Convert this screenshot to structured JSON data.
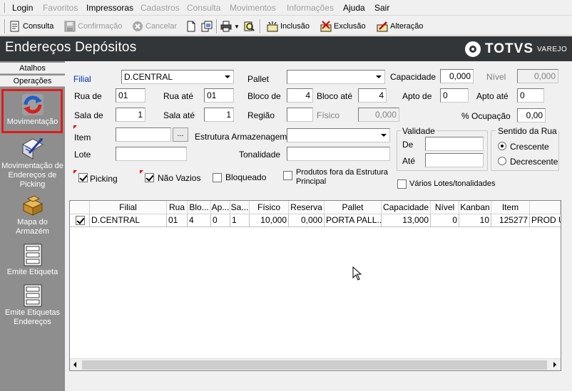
{
  "menubar": {
    "items": [
      {
        "label": "Login",
        "enabled": true
      },
      {
        "label": "Favoritos",
        "enabled": false
      },
      {
        "label": "Impressoras",
        "enabled": true
      },
      {
        "label": "Cadastros",
        "enabled": false
      },
      {
        "label": "Consulta",
        "enabled": false
      },
      {
        "label": "Movimentos",
        "enabled": false
      },
      {
        "label": "Informações",
        "enabled": false
      },
      {
        "label": "Ajuda",
        "enabled": true
      },
      {
        "label": "Sair",
        "enabled": true
      }
    ]
  },
  "toolbar": {
    "consulta": "Consulta",
    "confirmacao": "Confirmação",
    "cancelar": "Cancelar",
    "inclusao": "Inclusão",
    "exclusao": "Exclusão",
    "alteracao": "Alteração"
  },
  "header": {
    "title": "Endereços Depósitos",
    "brand": "TOTVS",
    "brand_sub": "VAREJO"
  },
  "sidebar": {
    "tab_atalhos": "Atalhos",
    "tab_operacoes": "Operações",
    "items": [
      {
        "label": "Movimentação",
        "icon": "movimentacao-icon"
      },
      {
        "label": "Movimentação de Endereços de Picking",
        "icon": "picking-icon"
      },
      {
        "label": "Mapa do Armazém",
        "icon": "warehouse-map-icon"
      },
      {
        "label": "Emite Etiqueta",
        "icon": "label-icon"
      },
      {
        "label": "Emite Etiquetas Endereços",
        "icon": "labels-icon"
      }
    ]
  },
  "form": {
    "filial_label": "Filial",
    "filial_value": "D.CENTRAL",
    "pallet_label": "Pallet",
    "pallet_value": "",
    "capacidade_label": "Capacidade",
    "capacidade_value": "0,000",
    "nivel_label": "Nível",
    "nivel_value": "0,000",
    "rua_de_label": "Rua de",
    "rua_de_value": "01",
    "rua_ate_label": "Rua até",
    "rua_ate_value": "01",
    "bloco_de_label": "Bloco de",
    "bloco_de_value": "4",
    "bloco_ate_label": "Bloco até",
    "bloco_ate_value": "4",
    "apto_de_label": "Apto de",
    "apto_de_value": "0",
    "apto_ate_label": "Apto até",
    "apto_ate_value": "0",
    "sala_de_label": "Sala de",
    "sala_de_value": "1",
    "sala_ate_label": "Sala até",
    "sala_ate_value": "1",
    "regiao_label": "Região",
    "regiao_value": "",
    "fisico_label": "Físico",
    "fisico_value": "0,000",
    "ocupacao_label": "% Ocupação",
    "ocupacao_value": "0,00",
    "item_label": "Item",
    "item_value": "",
    "item_button": "...",
    "estrutura_label": "Estrutura Armazenagem",
    "estrutura_value": "",
    "lote_label": "Lote",
    "lote_value": "",
    "tonalidade_label": "Tonalidade",
    "tonalidade_value": "",
    "validade_title": "Validade",
    "validade_de_label": "De",
    "validade_ate_label": "Até",
    "sentido_title": "Sentido da Rua",
    "crescente_label": "Crescente",
    "decrescente_label": "Decrescente",
    "sentido_selected": "Crescente",
    "picking_label": "Picking",
    "picking_checked": true,
    "nao_vazios_label": "Não Vazios",
    "nao_vazios_checked": true,
    "bloqueado_label": "Bloqueado",
    "bloqueado_checked": false,
    "produtos_fora_label_1": "Produtos fora da Estrutura",
    "produtos_fora_label_2": "Principal",
    "produtos_fora_checked": false,
    "varios_lotes_label": "Vários Lotes/tonalidades",
    "varios_lotes_checked": false
  },
  "grid": {
    "columns": [
      "",
      "Filial",
      "Rua",
      "Blo...",
      "Ap...",
      "Sa...",
      "Físico",
      "Reserva",
      "Pallet",
      "Capacidade",
      "Nível",
      "Kanban",
      "Item",
      ""
    ],
    "rows": [
      {
        "checked": true,
        "cells": [
          "D.CENTRAL",
          "01",
          "4",
          "0",
          "1",
          "10,000",
          "0,000",
          "PORTA PALL...",
          "13,000",
          "0",
          "10",
          "125277",
          "PROD U"
        ]
      }
    ]
  }
}
